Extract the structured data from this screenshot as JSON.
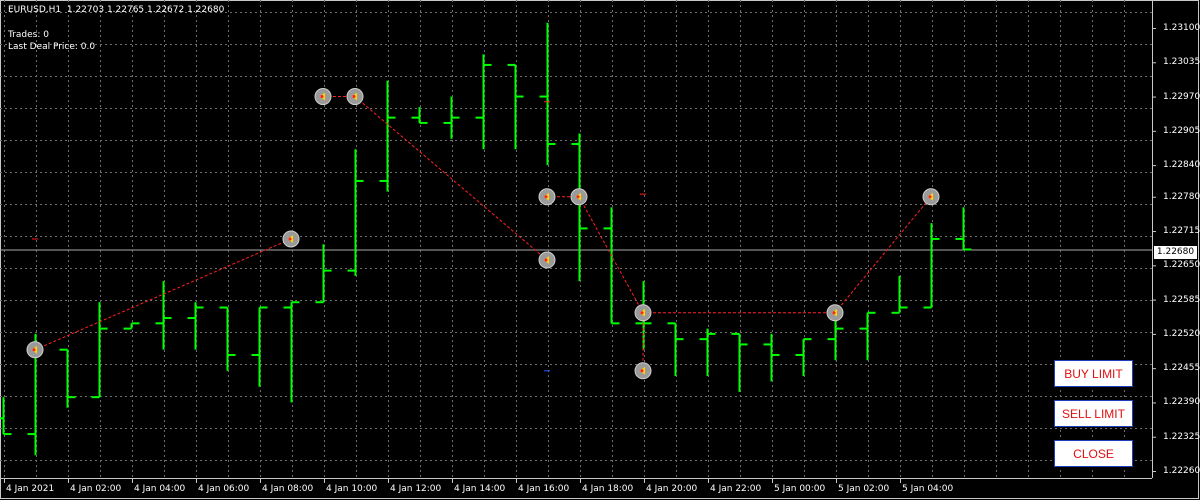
{
  "header": {
    "symbol": "EURUSD,H1",
    "ohlc": "1.22703 1.22765 1.22672 1.22680",
    "trades_label": "Trades: 0",
    "last_deal_label": "Last Deal Price: 0.0"
  },
  "colors": {
    "background": "#000000",
    "grid": "#6e6e6e",
    "bar": "#00ff00",
    "trade_line": "#ff2020",
    "button_text": "#e01010",
    "button_border": "#1f3fbf"
  },
  "price_axis": {
    "ticks": [
      "1.23100",
      "1.23035",
      "1.22970",
      "1.22905",
      "1.22840",
      "1.22780",
      "1.22715",
      "1.22650",
      "1.22585",
      "1.22520",
      "1.22455",
      "1.22390",
      "1.22325",
      "1.22260"
    ],
    "current_price": "1.22680",
    "range": [
      1.2226,
      1.231
    ]
  },
  "time_axis": {
    "ticks": [
      "4 Jan 2021",
      "4 Jan 02:00",
      "4 Jan 04:00",
      "4 Jan 06:00",
      "4 Jan 08:00",
      "4 Jan 10:00",
      "4 Jan 12:00",
      "4 Jan 14:00",
      "4 Jan 16:00",
      "4 Jan 18:00",
      "4 Jan 20:00",
      "4 Jan 22:00",
      "5 Jan 00:00",
      "5 Jan 02:00",
      "5 Jan 04:00"
    ]
  },
  "chart_data": {
    "type": "ohlc-bars",
    "symbol": "EURUSD",
    "timeframe": "H1",
    "bar_count": 31,
    "bars": [
      [
        1.2236,
        1.224,
        1.2233,
        1.2233
      ],
      [
        1.2233,
        1.2252,
        1.2229,
        1.2249
      ],
      [
        1.2249,
        1.2249,
        1.2238,
        1.224
      ],
      [
        1.224,
        1.2258,
        1.224,
        1.2253
      ],
      [
        1.2253,
        1.2254,
        1.2253,
        1.2254
      ],
      [
        1.2254,
        1.2262,
        1.2249,
        1.2255
      ],
      [
        1.2255,
        1.2258,
        1.2249,
        1.2257
      ],
      [
        1.2257,
        1.2257,
        1.2245,
        1.2248
      ],
      [
        1.2248,
        1.2257,
        1.2242,
        1.2257
      ],
      [
        1.2257,
        1.2258,
        1.2239,
        1.2258
      ],
      [
        1.2258,
        1.2269,
        1.2258,
        1.2264
      ],
      [
        1.2264,
        1.2287,
        1.2263,
        1.2281
      ],
      [
        1.2281,
        1.23,
        1.2279,
        1.2293
      ],
      [
        1.2293,
        1.2295,
        1.2292,
        1.2292
      ],
      [
        1.2292,
        1.2297,
        1.2289,
        1.2293
      ],
      [
        1.2293,
        1.2305,
        1.2287,
        1.2303
      ],
      [
        1.2303,
        1.2303,
        1.2287,
        1.2297
      ],
      [
        1.2297,
        1.2311,
        1.2284,
        1.2288
      ],
      [
        1.2288,
        1.229,
        1.2262,
        1.2272
      ],
      [
        1.2272,
        1.2276,
        1.2254,
        1.2254
      ],
      [
        1.2254,
        1.2262,
        1.2249,
        1.2254
      ],
      [
        1.2254,
        1.2254,
        1.2244,
        1.2251
      ],
      [
        1.2251,
        1.2253,
        1.2244,
        1.2252
      ],
      [
        1.2252,
        1.2252,
        1.2241,
        1.225
      ],
      [
        1.225,
        1.2252,
        1.2243,
        1.2248
      ],
      [
        1.2248,
        1.2251,
        1.2244,
        1.2251
      ],
      [
        1.2251,
        1.2255,
        1.2247,
        1.2253
      ],
      [
        1.2253,
        1.2256,
        1.2247,
        1.2256
      ],
      [
        1.2256,
        1.2263,
        1.2256,
        1.2257
      ],
      [
        1.2257,
        1.2273,
        1.2257,
        1.227
      ],
      [
        1.227,
        1.2276,
        1.2268,
        1.2268
      ]
    ],
    "trade_markers": [
      {
        "bar": 1,
        "price": 1.2249
      },
      {
        "bar": 9,
        "price": 1.227
      },
      {
        "bar": 10,
        "price": 1.2297
      },
      {
        "bar": 11,
        "price": 1.2297
      },
      {
        "bar": 17,
        "price": 1.2278
      },
      {
        "bar": 18,
        "price": 1.2278
      },
      {
        "bar": 17,
        "price": 1.2266
      },
      {
        "bar": 20,
        "price": 1.2256
      },
      {
        "bar": 20,
        "price": 1.2245
      },
      {
        "bar": 26,
        "price": 1.2256
      },
      {
        "bar": 29,
        "price": 1.2278
      }
    ],
    "trade_lines": [
      [
        [
          1,
          1.2249
        ],
        [
          9,
          1.227
        ]
      ],
      [
        [
          10,
          1.2297
        ],
        [
          11,
          1.2297
        ]
      ],
      [
        [
          11,
          1.2297
        ],
        [
          17,
          1.2266
        ]
      ],
      [
        [
          17,
          1.2278
        ],
        [
          18,
          1.2278
        ]
      ],
      [
        [
          18,
          1.2278
        ],
        [
          20,
          1.2256
        ]
      ],
      [
        [
          20,
          1.2256
        ],
        [
          26,
          1.2256
        ]
      ],
      [
        [
          20,
          1.2245
        ],
        [
          20,
          1.2256
        ]
      ],
      [
        [
          26,
          1.2256
        ],
        [
          29,
          1.2278
        ]
      ]
    ],
    "extra_points": [
      {
        "bar": 1,
        "price": 1.227,
        "color": "#ff2020"
      },
      {
        "bar": 17,
        "price": 1.2296,
        "color": "#ff2020"
      },
      {
        "bar": 20,
        "price": 1.22785,
        "color": "#ff2020"
      },
      {
        "bar": 17,
        "price": 1.2245,
        "color": "#3050ff"
      }
    ]
  },
  "buttons": {
    "buy_limit": "BUY LIMIT",
    "sell_limit": "SELL LIMIT",
    "close": "CLOSE"
  }
}
